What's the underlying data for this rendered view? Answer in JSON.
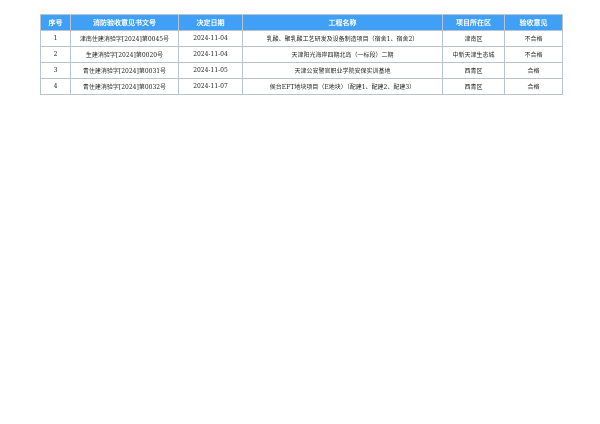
{
  "table": {
    "headers": [
      "序号",
      "消防验收意见书文号",
      "决定日期",
      "工程名称",
      "项目所在区",
      "验收意见"
    ],
    "rows": [
      [
        "1",
        "津南住建消验字[2024]第0045号",
        "2024-11-04",
        "乳酸、聚乳酸工艺研发及设备制造项目（宿舍1、宿舍2）",
        "津南区",
        "不合格"
      ],
      [
        "2",
        "生建消验字[2024]第0020号",
        "2024-11-04",
        "天津阳光海岸四期北岛（一标段）二期",
        "中新天津生态城",
        "不合格"
      ],
      [
        "3",
        "青住建消验字[2024]第0031号",
        "2024-11-05",
        "天津公安警官职业学院安保实训基地",
        "西青区",
        "合格"
      ],
      [
        "4",
        "青住建消验字[2024]第0032号",
        "2024-11-07",
        "侯台EFT地块项目（E地块）（配建1、配建2、配建3）",
        "西青区",
        "合格"
      ]
    ]
  }
}
